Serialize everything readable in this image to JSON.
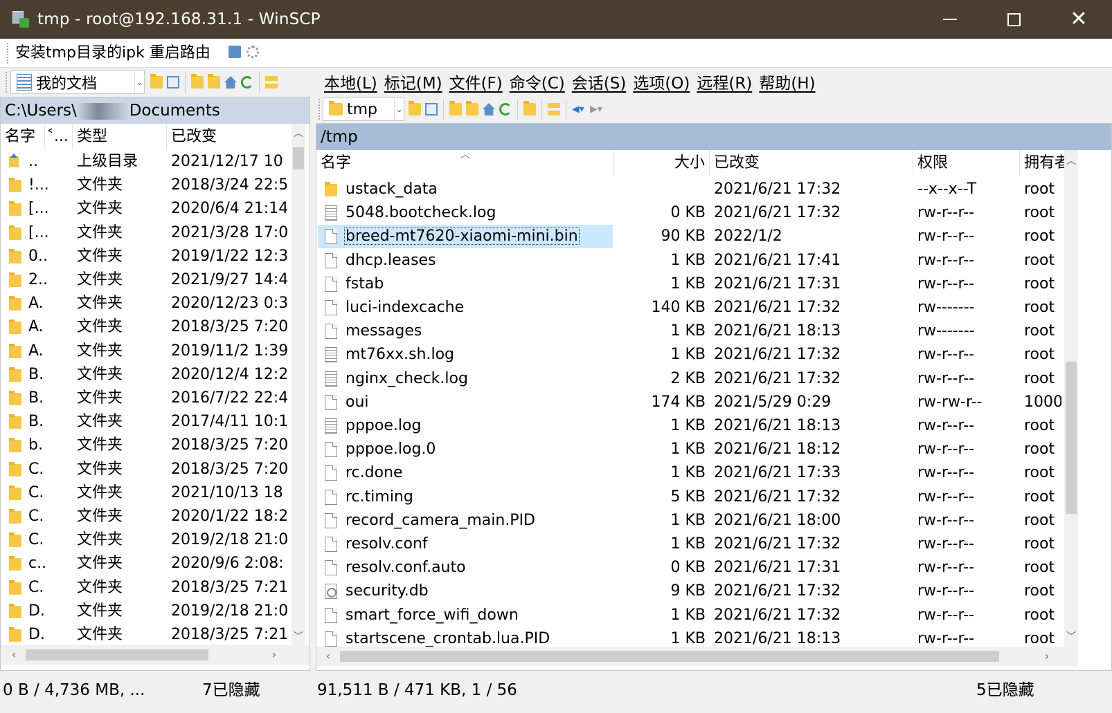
{
  "window": {
    "title": "tmp - root@192.168.31.1 - WinSCP",
    "minimize_symbol": "",
    "close_symbol": "✕"
  },
  "favorites": {
    "item_label": "安装tmp目录的ipk 重启路由"
  },
  "left_toolbar": {
    "location": "我的文档"
  },
  "menu": [
    "本地(L)",
    "标记(M)",
    "文件(F)",
    "命令(C)",
    "会话(S)",
    "选项(O)",
    "远程(R)",
    "帮助(H)"
  ],
  "right_toolbar": {
    "location": "tmp"
  },
  "left_panel": {
    "path_prefix": "C:\\Users\\",
    "path_suffix": "Documents",
    "columns": [
      "名字",
      "˂...",
      "类型",
      "已改变"
    ],
    "rows": [
      {
        "name": "..",
        "type": "上级目录",
        "changed": "2021/12/17  10",
        "icon": "up-folder-icon"
      },
      {
        "name": "!...",
        "type": "文件夹",
        "changed": "2018/3/24  22:5",
        "icon": "folder-icon"
      },
      {
        "name": "[...",
        "type": "文件夹",
        "changed": "2020/6/4  21:14",
        "icon": "folder-icon"
      },
      {
        "name": "[...",
        "type": "文件夹",
        "changed": "2021/3/28  17:0",
        "icon": "folder-icon"
      },
      {
        "name": "0..",
        "type": "文件夹",
        "changed": "2019/1/22  12:3",
        "icon": "folder-icon"
      },
      {
        "name": "2..",
        "type": "文件夹",
        "changed": "2021/9/27  14:4",
        "icon": "folder-icon"
      },
      {
        "name": "A.",
        "type": "文件夹",
        "changed": "2020/12/23  0:3",
        "icon": "folder-icon"
      },
      {
        "name": "A.",
        "type": "文件夹",
        "changed": "2018/3/25  7:20",
        "icon": "folder-icon"
      },
      {
        "name": "A.",
        "type": "文件夹",
        "changed": "2019/11/2  1:39",
        "icon": "folder-icon"
      },
      {
        "name": "B.",
        "type": "文件夹",
        "changed": "2020/12/4  12:2",
        "icon": "folder-icon"
      },
      {
        "name": "B.",
        "type": "文件夹",
        "changed": "2016/7/22  22:4",
        "icon": "folder-icon"
      },
      {
        "name": "B.",
        "type": "文件夹",
        "changed": "2017/4/11  10:1",
        "icon": "folder-icon"
      },
      {
        "name": "b.",
        "type": "文件夹",
        "changed": "2018/3/25  7:20",
        "icon": "folder-icon"
      },
      {
        "name": "C.",
        "type": "文件夹",
        "changed": "2018/3/25  7:20",
        "icon": "folder-icon"
      },
      {
        "name": "C.",
        "type": "文件夹",
        "changed": "2021/10/13  18",
        "icon": "folder-icon"
      },
      {
        "name": "C.",
        "type": "文件夹",
        "changed": "2020/1/22  18:2",
        "icon": "folder-icon"
      },
      {
        "name": "C.",
        "type": "文件夹",
        "changed": "2019/2/18  21:0",
        "icon": "folder-icon"
      },
      {
        "name": "c..",
        "type": "文件夹",
        "changed": "2020/9/6  2:08:",
        "icon": "folder-icon"
      },
      {
        "name": "C.",
        "type": "文件夹",
        "changed": "2018/3/25  7:21",
        "icon": "folder-icon"
      },
      {
        "name": "D.",
        "type": "文件夹",
        "changed": "2019/2/18  21:0",
        "icon": "folder-icon"
      },
      {
        "name": "D.",
        "type": "文件夹",
        "changed": "2018/3/25  7:21",
        "icon": "folder-icon"
      }
    ]
  },
  "right_panel": {
    "path": "/tmp",
    "columns": [
      "名字",
      "大小",
      "已改变",
      "权限",
      "拥有者"
    ],
    "selected_row": 2,
    "rows": [
      {
        "name": "ustack_data",
        "size": "",
        "changed": "2021/6/21 17:32",
        "rights": "--x--x--T",
        "owner": "root",
        "icon": "folder-icon"
      },
      {
        "name": "5048.bootcheck.log",
        "size": "0 KB",
        "changed": "2021/6/21 17:32",
        "rights": "rw-r--r--",
        "owner": "root",
        "icon": "text-file-icon"
      },
      {
        "name": "breed-mt7620-xiaomi-mini.bin",
        "size": "90 KB",
        "changed": "2022/1/2",
        "rights": "rw-r--r--",
        "owner": "root",
        "icon": "file-icon"
      },
      {
        "name": "dhcp.leases",
        "size": "1 KB",
        "changed": "2021/6/21 17:41",
        "rights": "rw-r--r--",
        "owner": "root",
        "icon": "file-icon"
      },
      {
        "name": "fstab",
        "size": "1 KB",
        "changed": "2021/6/21 17:31",
        "rights": "rw-r--r--",
        "owner": "root",
        "icon": "file-icon"
      },
      {
        "name": "luci-indexcache",
        "size": "140 KB",
        "changed": "2021/6/21 17:32",
        "rights": "rw-------",
        "owner": "root",
        "icon": "file-icon"
      },
      {
        "name": "messages",
        "size": "1 KB",
        "changed": "2021/6/21 18:13",
        "rights": "rw-------",
        "owner": "root",
        "icon": "file-icon"
      },
      {
        "name": "mt76xx.sh.log",
        "size": "1 KB",
        "changed": "2021/6/21 17:32",
        "rights": "rw-r--r--",
        "owner": "root",
        "icon": "text-file-icon"
      },
      {
        "name": "nginx_check.log",
        "size": "2 KB",
        "changed": "2021/6/21 17:32",
        "rights": "rw-r--r--",
        "owner": "root",
        "icon": "text-file-icon"
      },
      {
        "name": "oui",
        "size": "174 KB",
        "changed": "2021/5/29 0:29",
        "rights": "rw-rw-r--",
        "owner": "1000",
        "icon": "file-icon"
      },
      {
        "name": "pppoe.log",
        "size": "1 KB",
        "changed": "2021/6/21 18:13",
        "rights": "rw-r--r--",
        "owner": "root",
        "icon": "text-file-icon"
      },
      {
        "name": "pppoe.log.0",
        "size": "1 KB",
        "changed": "2021/6/21 18:12",
        "rights": "rw-r--r--",
        "owner": "root",
        "icon": "file-icon"
      },
      {
        "name": "rc.done",
        "size": "1 KB",
        "changed": "2021/6/21 17:33",
        "rights": "rw-r--r--",
        "owner": "root",
        "icon": "file-icon"
      },
      {
        "name": "rc.timing",
        "size": "5 KB",
        "changed": "2021/6/21 17:32",
        "rights": "rw-r--r--",
        "owner": "root",
        "icon": "file-icon"
      },
      {
        "name": "record_camera_main.PID",
        "size": "1 KB",
        "changed": "2021/6/21 18:00",
        "rights": "rw-r--r--",
        "owner": "root",
        "icon": "file-icon"
      },
      {
        "name": "resolv.conf",
        "size": "1 KB",
        "changed": "2021/6/21 17:32",
        "rights": "rw-r--r--",
        "owner": "root",
        "icon": "file-icon"
      },
      {
        "name": "resolv.conf.auto",
        "size": "0 KB",
        "changed": "2021/6/21 17:31",
        "rights": "rw-r--r--",
        "owner": "root",
        "icon": "file-icon"
      },
      {
        "name": "security.db",
        "size": "9 KB",
        "changed": "2021/6/21 17:32",
        "rights": "rw-r--r--",
        "owner": "root",
        "icon": "database-file-icon"
      },
      {
        "name": "smart_force_wifi_down",
        "size": "1 KB",
        "changed": "2021/6/21 17:32",
        "rights": "rw-r--r--",
        "owner": "root",
        "icon": "file-icon"
      },
      {
        "name": "startscene_crontab.lua.PID",
        "size": "1 KB",
        "changed": "2021/6/21 18:13",
        "rights": "rw-r--r--",
        "owner": "root",
        "icon": "file-icon"
      }
    ]
  },
  "status": {
    "left_size": "0 B / 4,736 MB,  ...",
    "left_hidden": "7已隐藏",
    "right_size": "91,511 B / 471 KB,   1 / 56",
    "right_hidden": "5已隐藏"
  },
  "colors": {
    "titlebar": "#4b3f30",
    "active_path": "#a7bcd6",
    "inactive_path": "#cbd7e6",
    "selection": "#cce8ff"
  }
}
